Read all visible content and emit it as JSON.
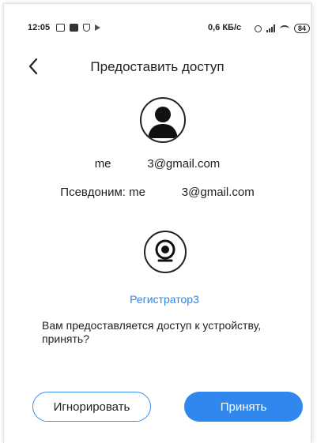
{
  "status_bar": {
    "time": "12:05",
    "network_speed": "0,6 КБ/с",
    "battery": "84"
  },
  "header": {
    "title": "Предоставить доступ"
  },
  "user": {
    "email": "me           3@gmail.com",
    "nickname": "Псевдоним: me           3@gmail.com"
  },
  "device": {
    "name": "Регистратор3"
  },
  "message": "Вам предоставляется доступ к устройству, принять?",
  "actions": {
    "ignore_label": "Игнорировать",
    "accept_label": "Принять"
  },
  "colors": {
    "accent": "#3088ee",
    "link": "#2d86e8"
  }
}
